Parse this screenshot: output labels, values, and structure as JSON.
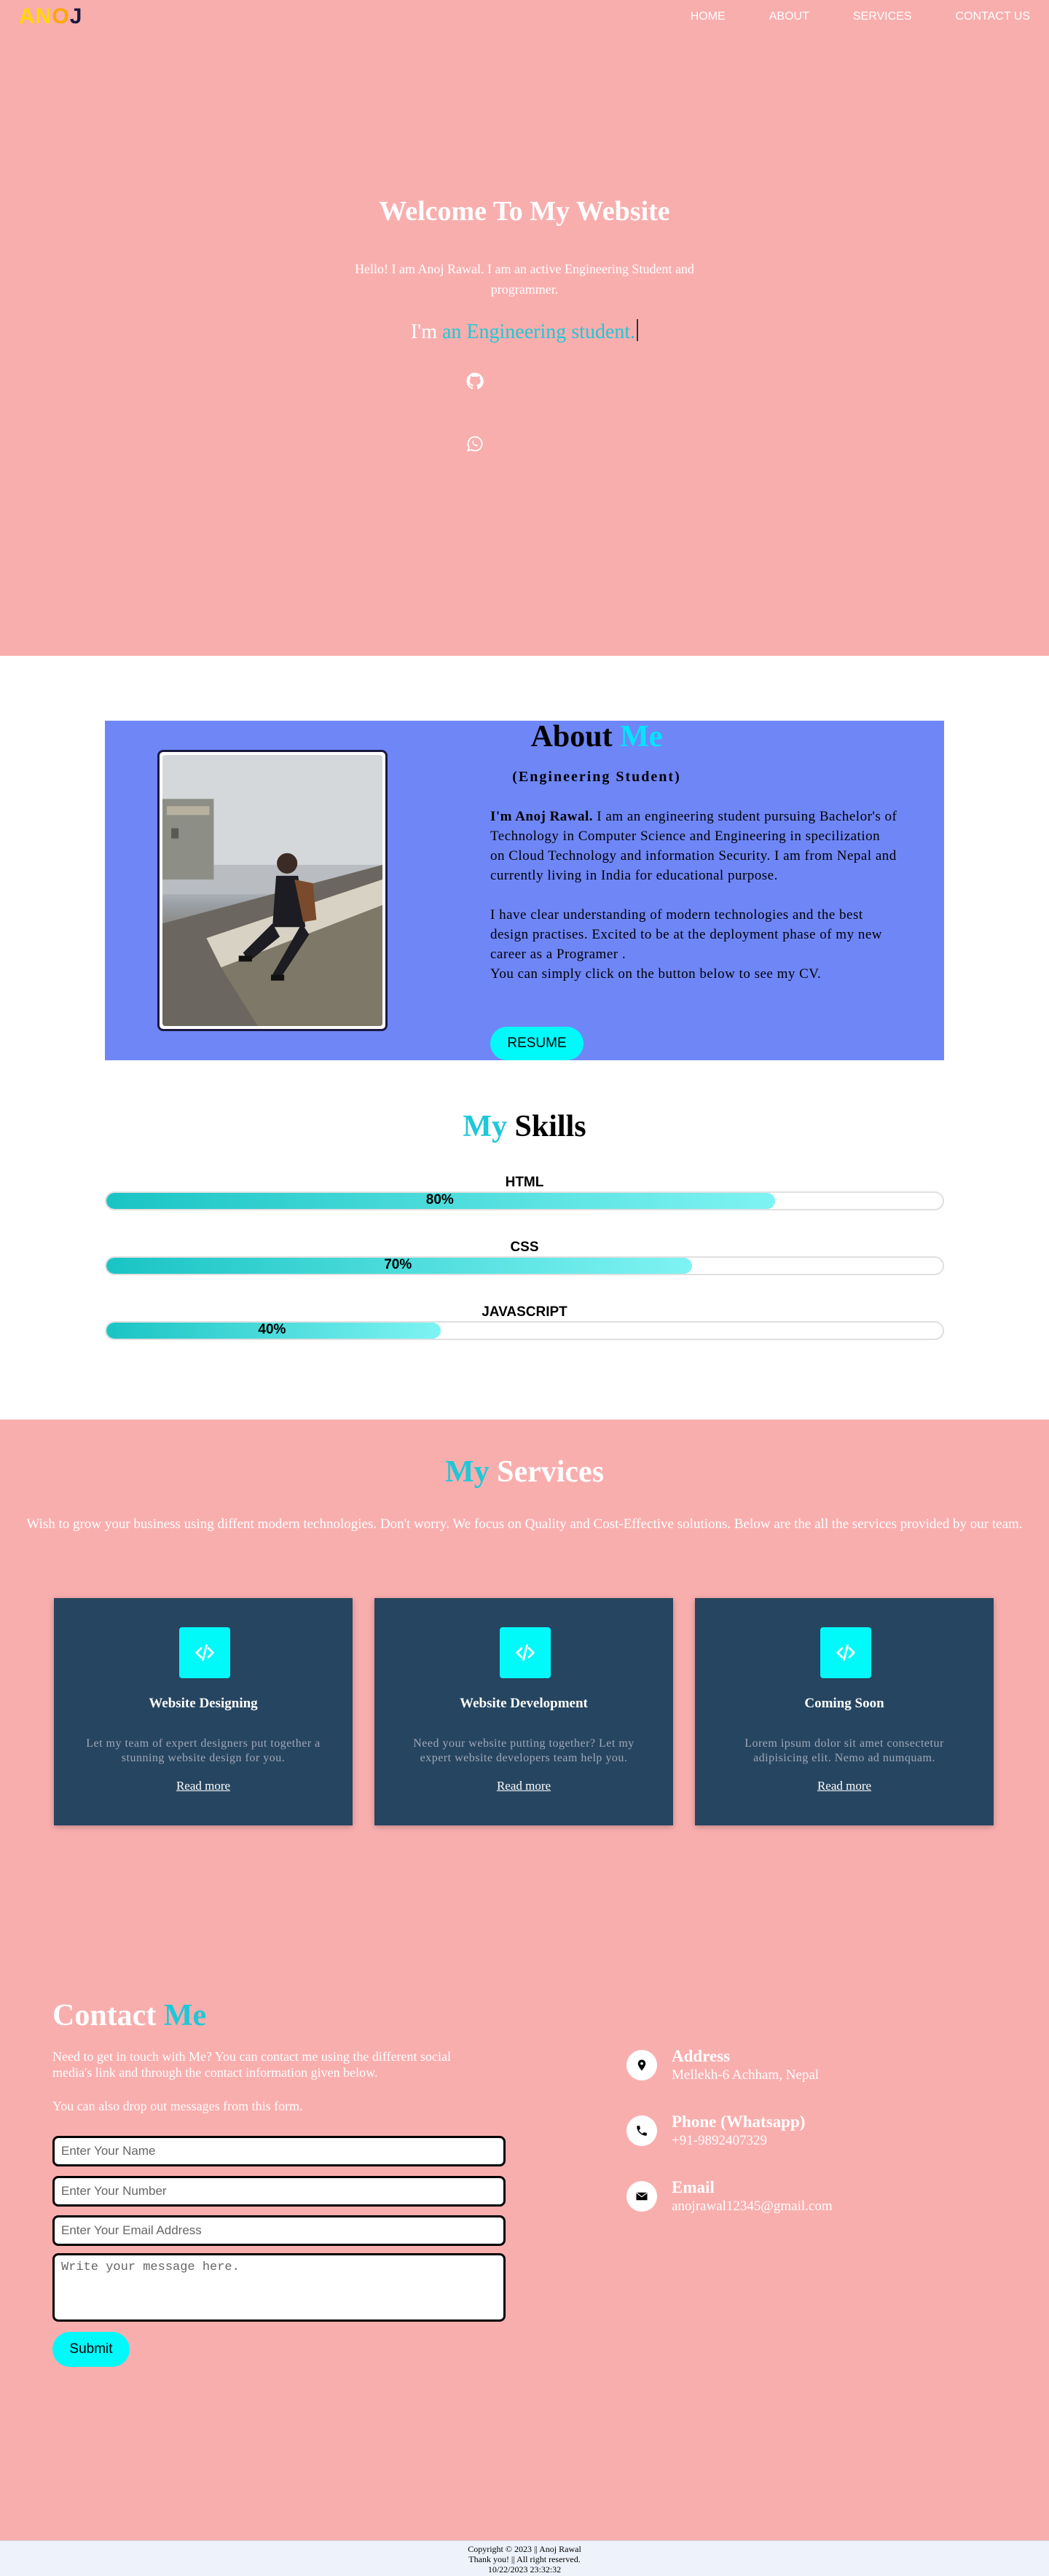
{
  "logo": {
    "part1": "AN",
    "part2": "O",
    "part3": "J"
  },
  "nav": {
    "items": [
      "HOME",
      "ABOUT",
      "SERVICES",
      "CONTACT US"
    ]
  },
  "hero": {
    "title": "Welcome To My Website",
    "subtitle": "Hello! I am Anoj Rawal. I am an active Engineering Student and programmer.",
    "typed_prefix": "I'm",
    "typed_text": "an Engineering student.",
    "icons": [
      "github-icon",
      "whatsapp-icon"
    ]
  },
  "about": {
    "title_part1": "About",
    "title_part2": "Me",
    "role": "(Engineering Student)",
    "intro_bold": "I'm Anoj Rawal.",
    "intro": "I am an engineering student pursuing Bachelor's of Technology in Computer Science and Engineering in specilization on Cloud Technology and information Security. I am from Nepal and currently living in India for educational purpose.",
    "paragraph2": "I have clear understanding of modern technologies and the best design practises. Excited to be at the deployment phase of my new career as a Programer .",
    "paragraph3": "You can simply click on the button below to see my CV.",
    "resume_label": "RESUME"
  },
  "skills": {
    "title_part1": "My",
    "title_part2": "Skills",
    "items": [
      {
        "name": "HTML",
        "percent": 80,
        "label": "80%"
      },
      {
        "name": "CSS",
        "percent": 70,
        "label": "70%"
      },
      {
        "name": "JAVASCRIPT",
        "percent": 40,
        "label": "40%"
      }
    ]
  },
  "services": {
    "title_part1": "My",
    "title_part2": "Services",
    "description": "Wish to grow your business using diffent modern technologies. Don't worry. We focus on Quality and Cost-Effective solutions. Below are the all the services provided by our team.",
    "cards": [
      {
        "title": "Website Designing",
        "text": "Let my team of expert designers put together a stunning website design for you.",
        "link": "Read more"
      },
      {
        "title": "Website Development",
        "text": "Need your website putting together? Let my expert website developers team help you.",
        "link": "Read more"
      },
      {
        "title": "Coming Soon",
        "text": "Lorem ipsum dolor sit amet consectetur adipisicing elit. Nemo ad numquam.",
        "link": "Read more"
      }
    ]
  },
  "contact": {
    "title_part1": "Contact",
    "title_part2": "Me",
    "description": "Need to get in touch with Me? You can contact me using the different social media's link and through the contact information given below.",
    "description2": "You can also drop out messages from this form.",
    "name_placeholder": "Enter Your Name",
    "number_placeholder": "Enter Your Number",
    "email_placeholder": "Enter Your Email Address",
    "message_placeholder": "Write your message here.",
    "submit_label": "Submit",
    "info": [
      {
        "label": "Address",
        "value": "Mellekh-6 Achham, Nepal",
        "icon": "location-pin-icon"
      },
      {
        "label": "Phone (Whatsapp)",
        "value": "+91-9892407329",
        "icon": "phone-icon"
      },
      {
        "label": "Email",
        "value": "anojrawal12345@gmail.com",
        "icon": "envelope-icon"
      }
    ]
  },
  "footer": {
    "copyright": "Copyright © 2023 || Anoj Rawal",
    "thanks": "Thank you! || All right reserved.",
    "timestamp": "10/22/2023 23:32:32"
  },
  "colors": {
    "hero_bg": "#f9aeae",
    "accent": "#1ec8d8",
    "about_bg": "#6f86f7",
    "card_bg": "#264560",
    "button": "#00fafa"
  }
}
